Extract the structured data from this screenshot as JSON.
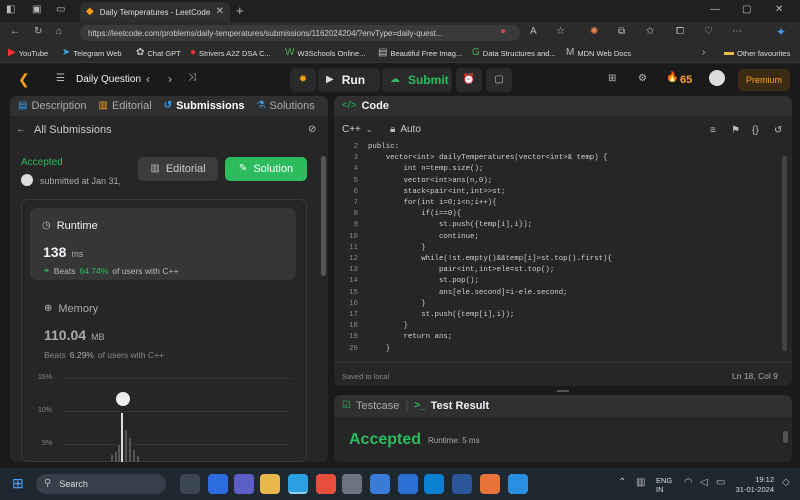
{
  "browser": {
    "tab_title": "Daily Temperatures - LeetCode",
    "url": "https://leetcode.com/problems/daily-temperatures/submissions/1162024204/?envType=daily-quest...",
    "bookmarks": [
      "YouTube",
      "Telegram Web",
      "Chat GPT",
      "Strivers A2Z DSA C...",
      "W3Schools Online...",
      "Beautiful Free Imag...",
      "Data Structures and...",
      "MDN Web Docs",
      "Other favourites"
    ]
  },
  "header": {
    "daily_question": "Daily Question",
    "run": "Run",
    "submit": "Submit",
    "streak": "65",
    "premium": "Premium"
  },
  "left": {
    "tabs": [
      "Description",
      "Editorial",
      "Submissions",
      "Solutions"
    ],
    "all_submissions": "All Submissions",
    "status": "Accepted",
    "submitted": "submitted at Jan 31,",
    "editorial_btn": "Editorial",
    "solution_btn": "Solution",
    "runtime_label": "Runtime",
    "runtime_value": "138",
    "runtime_unit": "ms",
    "runtime_beats_prefix": "Beats",
    "runtime_beats": "64.74%",
    "runtime_beats_suffix": "of users with C++",
    "memory_label": "Memory",
    "memory_value": "110.04",
    "memory_unit": "MB",
    "memory_beats_prefix": "Beats",
    "memory_beats": "6.29%",
    "memory_beats_suffix": "of users with C++",
    "y_ticks": [
      "15%",
      "10%",
      "5%"
    ]
  },
  "code": {
    "title": "Code",
    "lang": "C++",
    "auto": "Auto",
    "saved": "Saved to local",
    "cursor": "Ln 18, Col 9",
    "lines": [
      {
        "n": "2",
        "t": "public:"
      },
      {
        "n": "3",
        "t": "    vector<int> dailyTemperatures(vector<int>& temp) {"
      },
      {
        "n": "4",
        "t": "        int n=temp.size();"
      },
      {
        "n": "5",
        "t": "        vector<int>ans(n,0);"
      },
      {
        "n": "6",
        "t": "        stack<pair<int,int>>st;"
      },
      {
        "n": "7",
        "t": "        for(int i=0;i<n;i++){"
      },
      {
        "n": "8",
        "t": "            if(i==0){"
      },
      {
        "n": "9",
        "t": "                st.push({temp[i],i});"
      },
      {
        "n": "10",
        "t": "                continue;"
      },
      {
        "n": "11",
        "t": "            }"
      },
      {
        "n": "12",
        "t": "            while(!st.empty()&&temp[i]>st.top().first){"
      },
      {
        "n": "13",
        "t": "                pair<int,int>ele=st.top();"
      },
      {
        "n": "14",
        "t": "                st.pop();"
      },
      {
        "n": "15",
        "t": "                ans[ele.second]=i-ele.second;"
      },
      {
        "n": "16",
        "t": "            }"
      },
      {
        "n": "17",
        "t": "            st.push({temp[i],i});"
      },
      {
        "n": "18",
        "t": "        }"
      },
      {
        "n": "19",
        "t": "        return ans;"
      },
      {
        "n": "20",
        "t": "    }"
      }
    ]
  },
  "result": {
    "testcase": "Testcase",
    "test_result": "Test Result",
    "status": "Accepted",
    "runtime": "Runtime: 5 ms"
  },
  "taskbar": {
    "search": "Search",
    "lang1": "ENG",
    "lang2": "IN",
    "time": "19:12",
    "date": "31-01-2024"
  },
  "colors": {
    "accent_green": "#2cbb5d",
    "premium": "#ffa116",
    "blue": "#3d9cf0"
  }
}
